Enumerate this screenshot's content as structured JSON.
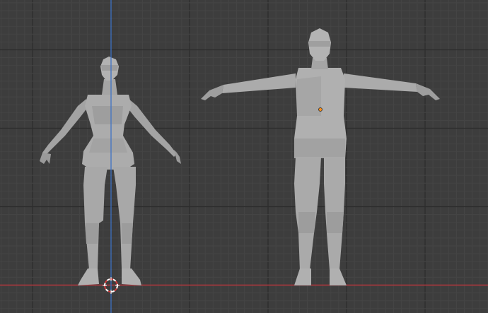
{
  "viewport": {
    "background": "#3d3d3d",
    "grid_minor_color": "#454545",
    "grid_major_color": "#2c2c2c",
    "x_axis_color": "#b8383f",
    "z_axis_color": "#3f72c4",
    "mesh_color": "#a9a9a9",
    "mesh_shadow_color": "#8f8f8f",
    "origin_color": "#ff8c1a",
    "cursor_colors": [
      "#ffffff",
      "#d23a3a"
    ]
  },
  "objects": [
    {
      "name": "female-mesh",
      "pose": "A-pose"
    },
    {
      "name": "male-mesh",
      "pose": "T-pose"
    }
  ]
}
